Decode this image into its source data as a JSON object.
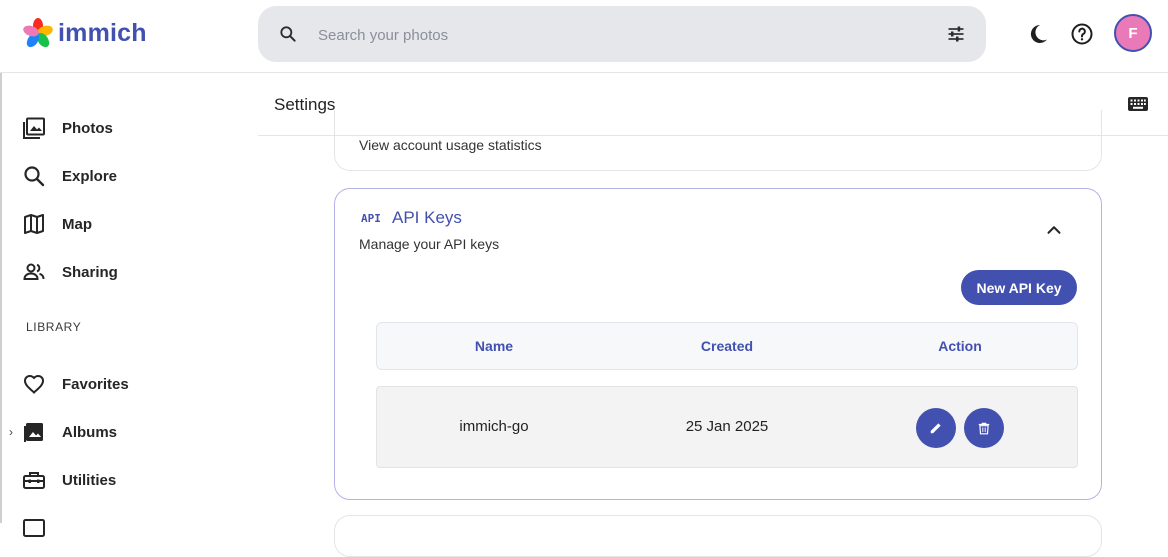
{
  "app": {
    "name": "immich"
  },
  "search": {
    "placeholder": "Search your photos"
  },
  "header": {
    "avatar_initial": "F"
  },
  "sidebar": {
    "items": [
      {
        "label": "Photos"
      },
      {
        "label": "Explore"
      },
      {
        "label": "Map"
      },
      {
        "label": "Sharing"
      }
    ],
    "library_label": "LIBRARY",
    "library_items": [
      {
        "label": "Favorites"
      },
      {
        "label": "Albums"
      },
      {
        "label": "Utilities"
      }
    ]
  },
  "settings": {
    "title": "Settings",
    "usage_card": {
      "description": "View account usage statistics"
    },
    "api_keys": {
      "badge": "API",
      "title": "API Keys",
      "description": "Manage your API keys",
      "new_button": "New API Key",
      "columns": [
        "Name",
        "Created",
        "Action"
      ],
      "rows": [
        {
          "name": "immich-go",
          "created": "25 Jan 2025"
        }
      ]
    }
  },
  "colors": {
    "accent": "#4250af",
    "avatar_bg": "#ea79b8"
  },
  "icons": [
    "search-icon",
    "filter-icon",
    "moon-icon",
    "help-icon",
    "photos-icon",
    "explore-icon",
    "map-icon",
    "sharing-icon",
    "heart-icon",
    "albums-icon",
    "toolbox-icon",
    "keyboard-icon",
    "chevron-up-icon",
    "pencil-icon",
    "trash-icon"
  ]
}
